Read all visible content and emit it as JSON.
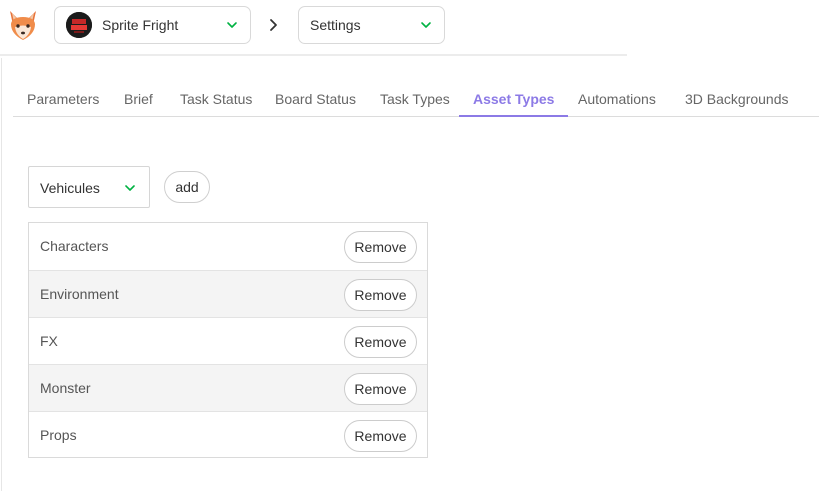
{
  "topbar": {
    "logo_icon": "kitsu-fox-logo",
    "production": {
      "label": "Sprite Fright",
      "avatar_icon": "production-thumbnail"
    },
    "separator_icon": "chevron-right-icon",
    "section": {
      "label": "Settings"
    }
  },
  "tabs": [
    {
      "label": "Parameters",
      "active": false
    },
    {
      "label": "Brief",
      "active": false
    },
    {
      "label": "Task Status",
      "active": false
    },
    {
      "label": "Board Status",
      "active": false
    },
    {
      "label": "Task Types",
      "active": false
    },
    {
      "label": "Asset Types",
      "active": true
    },
    {
      "label": "Automations",
      "active": false
    },
    {
      "label": "3D Backgrounds",
      "active": false
    }
  ],
  "asset_types": {
    "select_value": "Vehicules",
    "add_label": "add",
    "remove_label": "Remove",
    "rows": [
      {
        "label": "Characters"
      },
      {
        "label": "Environment"
      },
      {
        "label": "FX"
      },
      {
        "label": "Monster"
      },
      {
        "label": "Props"
      }
    ]
  },
  "colors": {
    "accent": "#8c7ae6",
    "chevron": "#00b242"
  }
}
